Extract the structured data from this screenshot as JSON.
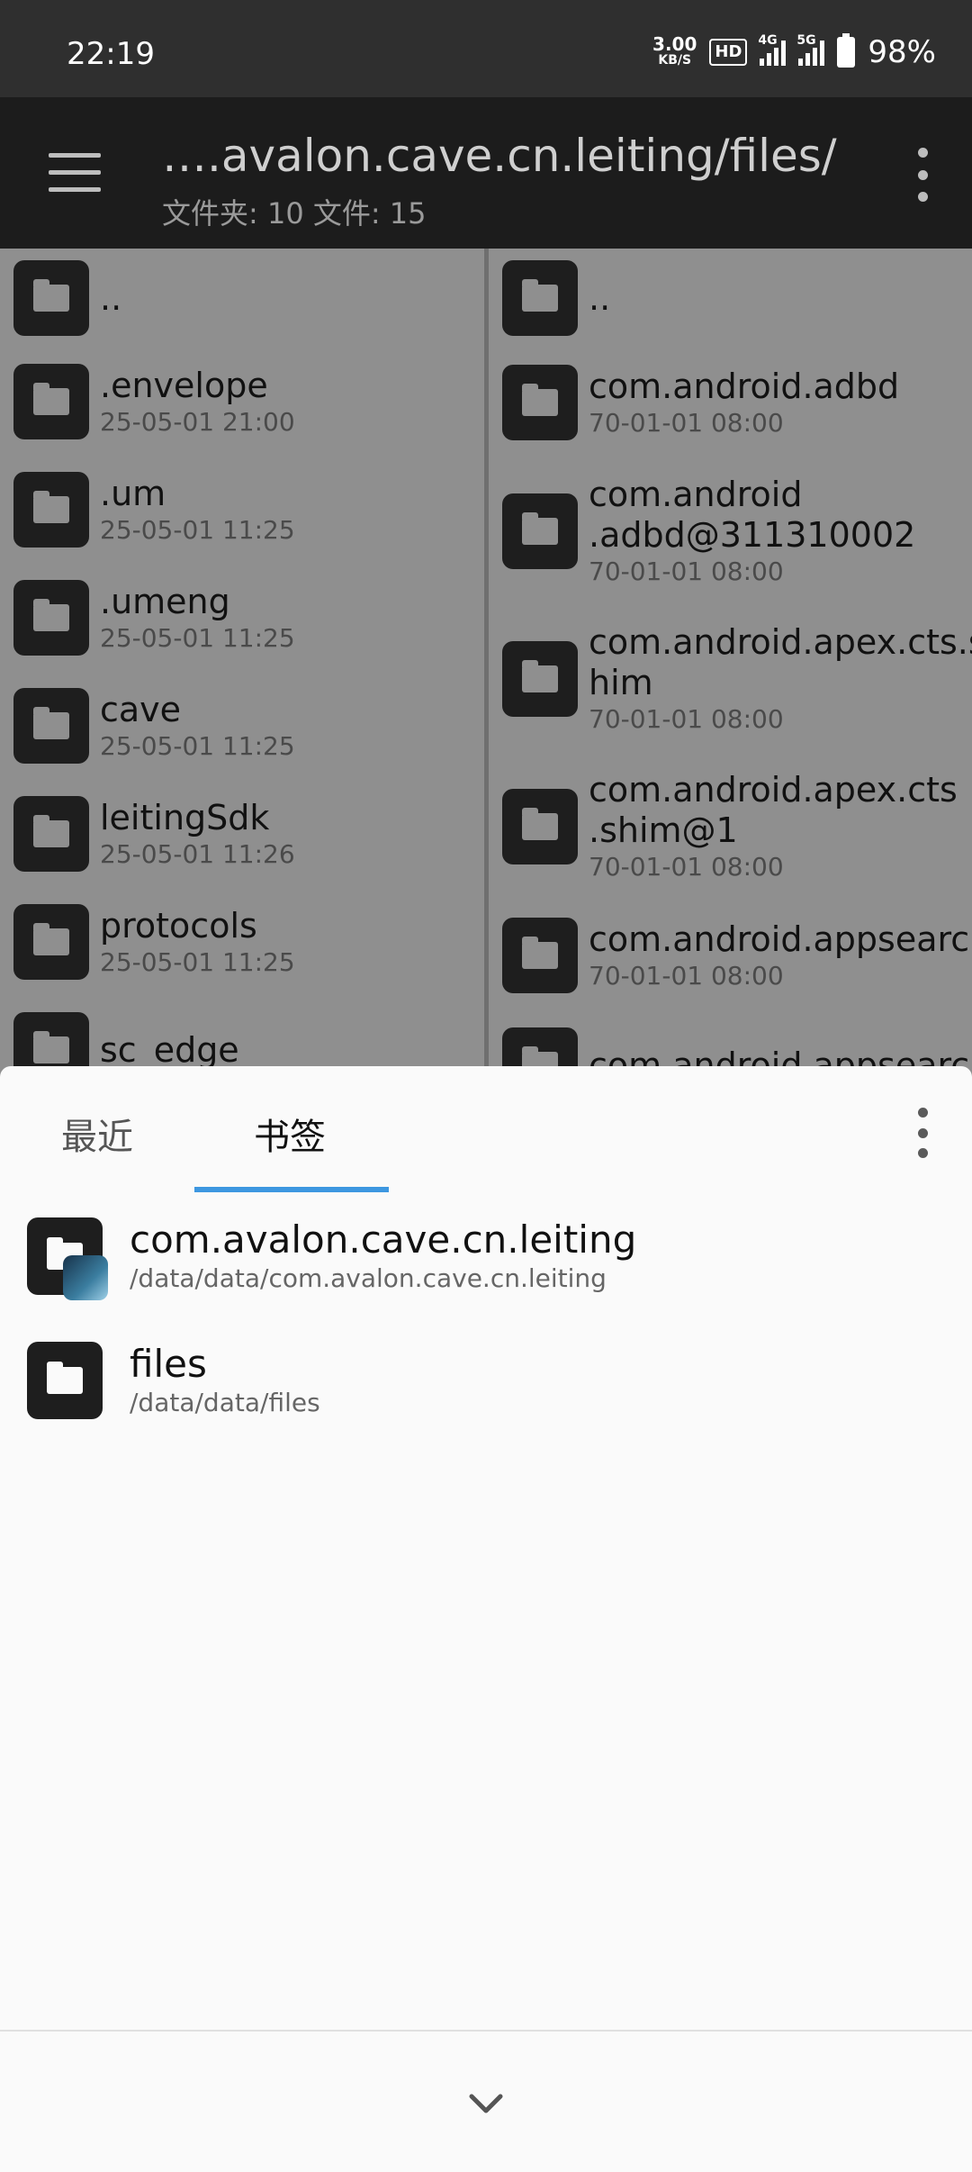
{
  "status_bar": {
    "time": "22:19",
    "speed_value": "3.00",
    "speed_unit": "KB/S",
    "hd": "HD",
    "net1": "4G",
    "net2": "5G",
    "battery": "98%"
  },
  "toolbar": {
    "path": "….avalon.cave.cn.leiting/files/",
    "summary": "文件夹: 10  文件: 15"
  },
  "left_pane": {
    "items": [
      {
        "name": "..",
        "date": ""
      },
      {
        "name": ".envelope",
        "date": "25-05-01 21:00"
      },
      {
        "name": ".um",
        "date": "25-05-01 11:25"
      },
      {
        "name": ".umeng",
        "date": "25-05-01 11:25"
      },
      {
        "name": "cave",
        "date": "25-05-01 11:25"
      },
      {
        "name": "leitingSdk",
        "date": "25-05-01 11:26"
      },
      {
        "name": "protocols",
        "date": "25-05-01 11:25"
      },
      {
        "name": "sc_edge",
        "date": ""
      }
    ]
  },
  "right_pane": {
    "items": [
      {
        "name": "..",
        "date": ""
      },
      {
        "name": "com.android.adbd",
        "date": "70-01-01 08:00"
      },
      {
        "name": "com.android\n.adbd@311310002",
        "date": "70-01-01 08:00"
      },
      {
        "name": "com.android.apex.cts.s\nhim",
        "date": "70-01-01 08:00"
      },
      {
        "name": "com.android.apex.cts\n.shim@1",
        "date": "70-01-01 08:00"
      },
      {
        "name": "com.android.appsearch",
        "date": "70-01-01 08:00"
      },
      {
        "name": "com.android.appsearch",
        "date": ""
      }
    ]
  },
  "sheet": {
    "tabs": [
      "最近",
      "书签"
    ],
    "bookmarks": [
      {
        "name": "com.avalon.cave.cn.leiting",
        "path": "/data/data/com.avalon.cave.cn.leiting"
      },
      {
        "name": "files",
        "path": "/data/data/files"
      }
    ]
  },
  "colors": {
    "accent": "#3d97e0",
    "toolbar": "#1c1c1c",
    "status_bar": "#2f2f2f",
    "pane_bg": "#8f8f8f"
  },
  "icons": {
    "menu": "hamburger-icon",
    "more": "more-vert-icon",
    "folder": "folder-icon",
    "collapse": "chevron-down-icon"
  }
}
